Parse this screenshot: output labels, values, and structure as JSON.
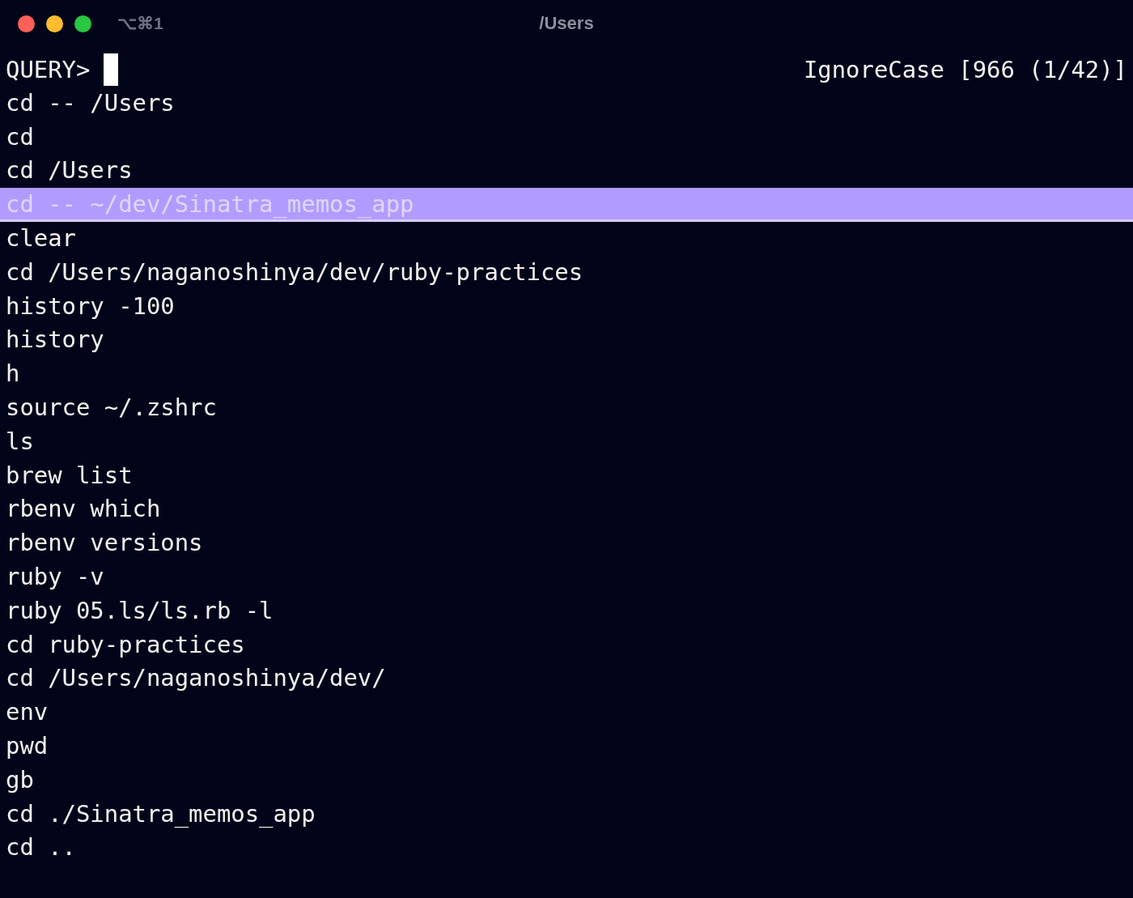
{
  "window": {
    "title": "/Users",
    "shortcut": "⌥⌘1"
  },
  "query": {
    "prompt": "QUERY>",
    "status": "IgnoreCase [966 (1/42)]"
  },
  "rows": [
    {
      "text": "cd -- /Users",
      "selected": false
    },
    {
      "text": "cd",
      "selected": false
    },
    {
      "text": "cd /Users",
      "selected": false
    },
    {
      "text": "cd -- ~/dev/Sinatra_memos_app",
      "selected": true
    },
    {
      "text": "clear",
      "selected": false
    },
    {
      "text": "cd /Users/naganoshinya/dev/ruby-practices",
      "selected": false
    },
    {
      "text": "history -100",
      "selected": false
    },
    {
      "text": "history",
      "selected": false
    },
    {
      "text": "h",
      "selected": false
    },
    {
      "text": "source ~/.zshrc",
      "selected": false
    },
    {
      "text": "ls",
      "selected": false
    },
    {
      "text": "brew list",
      "selected": false
    },
    {
      "text": "rbenv which",
      "selected": false
    },
    {
      "text": "rbenv versions",
      "selected": false
    },
    {
      "text": "ruby -v",
      "selected": false
    },
    {
      "text": "ruby 05.ls/ls.rb -l",
      "selected": false
    },
    {
      "text": "cd ruby-practices",
      "selected": false
    },
    {
      "text": "cd /Users/naganoshinya/dev/",
      "selected": false
    },
    {
      "text": "env",
      "selected": false
    },
    {
      "text": "pwd",
      "selected": false
    },
    {
      "text": "gb",
      "selected": false
    },
    {
      "text": "cd ./Sinatra_memos_app",
      "selected": false
    },
    {
      "text": "cd ..",
      "selected": false
    }
  ]
}
